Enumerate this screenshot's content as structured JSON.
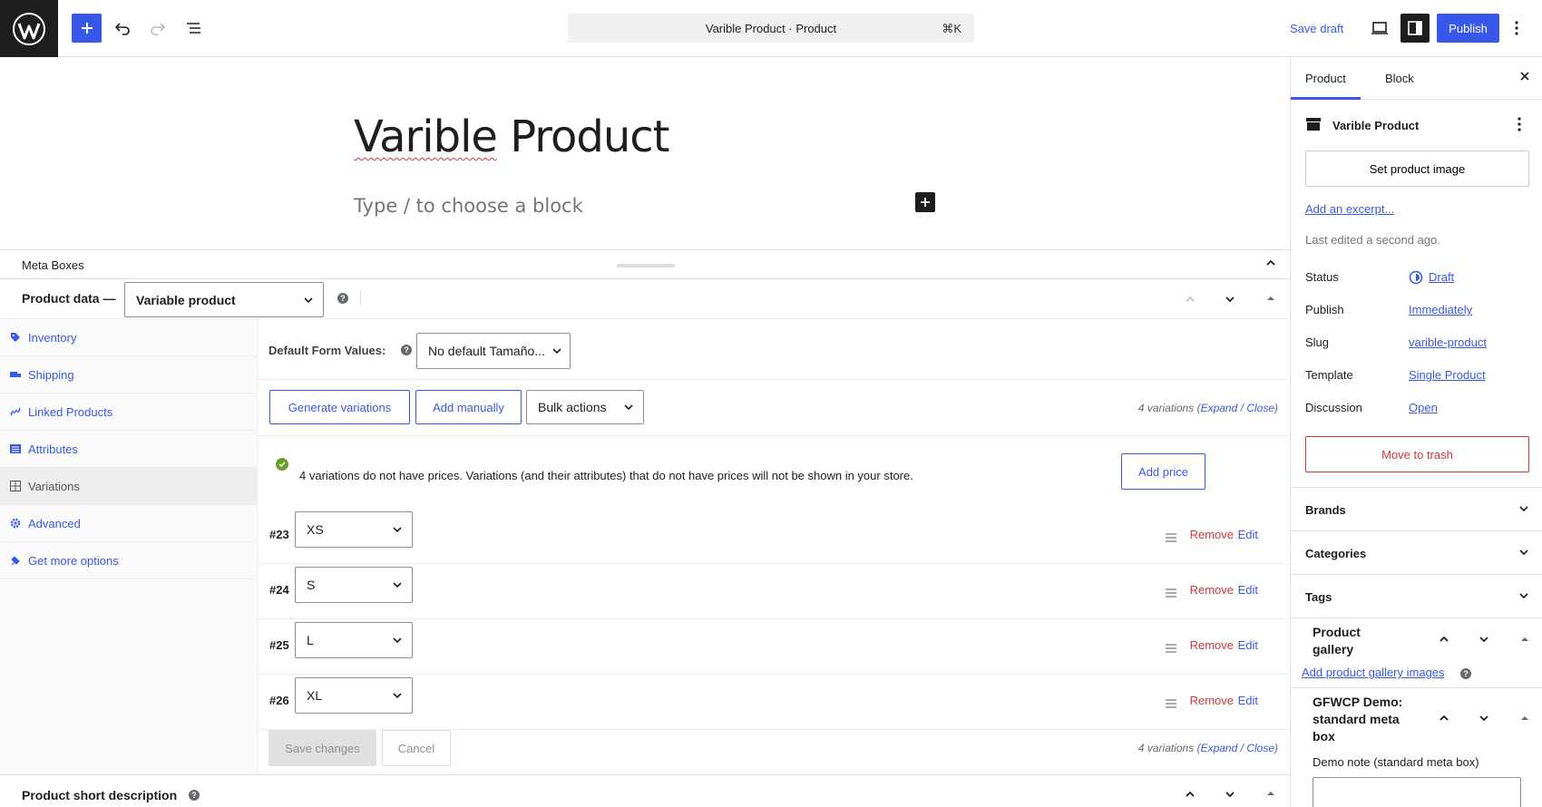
{
  "topbar": {
    "command_bar": "Varible Product · Product",
    "command_shortcut": "⌘K",
    "save_draft": "Save draft",
    "publish": "Publish"
  },
  "editor": {
    "title_word1": "Varible",
    "title_word2": "Product",
    "placeholder": "Type / to choose a block"
  },
  "meta_boxes": {
    "label": "Meta Boxes"
  },
  "product_data": {
    "label": "Product data —",
    "type_selected": "Variable product",
    "help": "?",
    "tabs": [
      {
        "label": "Inventory",
        "icon": "tag-icon"
      },
      {
        "label": "Shipping",
        "icon": "truck-icon"
      },
      {
        "label": "Linked Products",
        "icon": "link-icon"
      },
      {
        "label": "Attributes",
        "icon": "list-icon"
      },
      {
        "label": "Variations",
        "icon": "grid-icon"
      },
      {
        "label": "Advanced",
        "icon": "gear-icon"
      },
      {
        "label": "Get more options",
        "icon": "plugin-icon"
      }
    ]
  },
  "variations": {
    "default_form_label": "Default Form Values:",
    "default_form_value": "No default Tamaño...",
    "generate_button": "Generate variations",
    "add_manually_button": "Add manually",
    "bulk_actions": "Bulk actions",
    "count_text": "4 variations",
    "expand": "Expand",
    "sep": "/",
    "close": "Close",
    "notice": "4 variations do not have prices. Variations (and their attributes) that do not have prices will not be shown in your store.",
    "add_price": "Add price",
    "rows": [
      {
        "id": "#23",
        "value": "XS",
        "remove": "Remove",
        "edit": "Edit"
      },
      {
        "id": "#24",
        "value": "S",
        "remove": "Remove",
        "edit": "Edit"
      },
      {
        "id": "#25",
        "value": "L",
        "remove": "Remove",
        "edit": "Edit"
      },
      {
        "id": "#26",
        "value": "XL",
        "remove": "Remove",
        "edit": "Edit"
      }
    ],
    "save_changes": "Save changes",
    "cancel": "Cancel"
  },
  "short_description": {
    "label": "Product short description"
  },
  "sidebar": {
    "tab_product": "Product",
    "tab_block": "Block",
    "post_name": "Varible Product",
    "set_image": "Set product image",
    "add_excerpt": "Add an excerpt...",
    "last_edited": "Last edited a second ago.",
    "fields": [
      {
        "label": "Status",
        "value": "Draft"
      },
      {
        "label": "Publish",
        "value": "Immediately"
      },
      {
        "label": "Slug",
        "value": "varible-product"
      },
      {
        "label": "Template",
        "value": "Single Product"
      },
      {
        "label": "Discussion",
        "value": "Open"
      }
    ],
    "move_to_trash": "Move to trash",
    "panels": [
      "Brands",
      "Categories",
      "Tags"
    ],
    "gallery_title_1": "Product",
    "gallery_title_2": "gallery",
    "gallery_link": "Add product gallery images",
    "gfwcp_title_1": "GFWCP Demo:",
    "gfwcp_title_2": "standard meta",
    "gfwcp_title_3": "box",
    "demo_note": "Demo note (standard meta box)"
  },
  "colors": {
    "accent": "#3858e9",
    "danger": "#d63638",
    "dark": "#1e1e1e",
    "success": "#68a127"
  }
}
